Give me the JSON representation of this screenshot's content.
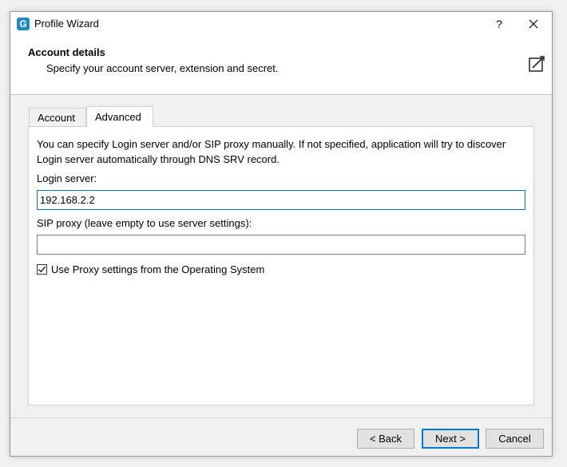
{
  "window": {
    "title": "Profile Wizard",
    "app_icon_letter": "G",
    "help_label": "?"
  },
  "header": {
    "title": "Account details",
    "subtitle": "Specify your account server, extension and secret."
  },
  "tabs": [
    {
      "label": "Account",
      "selected": false
    },
    {
      "label": "Advanced",
      "selected": true
    }
  ],
  "advanced": {
    "description": "You can specify Login server and/or SIP proxy manually. If not specified, application will try to discover Login server automatically through DNS SRV record.",
    "login_server_label": "Login server:",
    "login_server_value": "192.168.2.2",
    "sip_proxy_label": "SIP proxy (leave empty to use server settings):",
    "sip_proxy_value": "",
    "use_proxy_label": "Use Proxy settings from the Operating System",
    "use_proxy_checked": true
  },
  "buttons": {
    "back": "< Back",
    "next": "Next >",
    "cancel": "Cancel"
  },
  "colors": {
    "accent": "#0078d7",
    "app_icon": "#1e88c7"
  }
}
